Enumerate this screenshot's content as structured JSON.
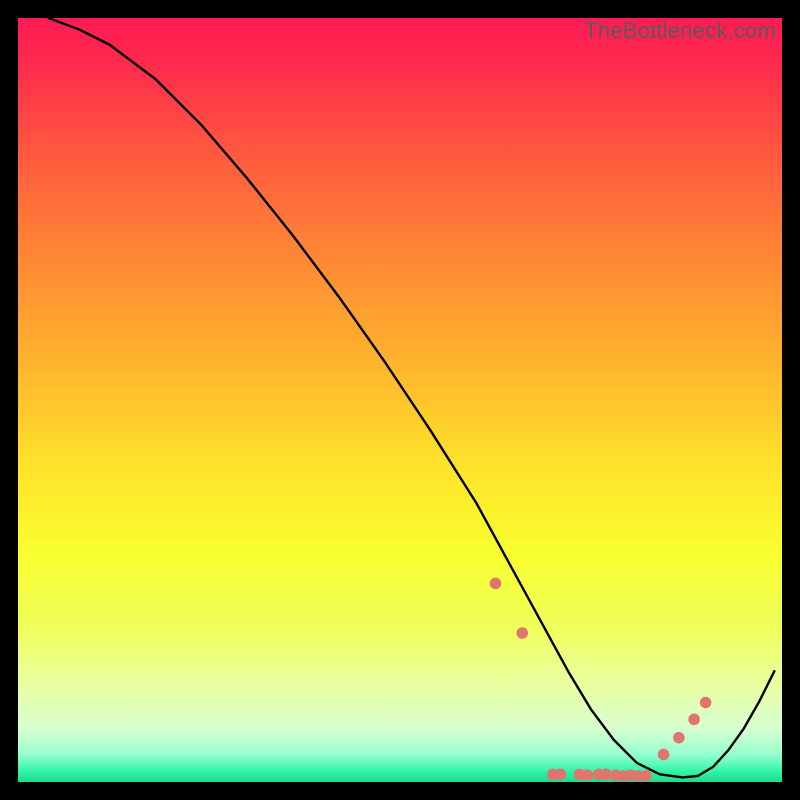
{
  "watermark": "TheBottleneck.com",
  "chart_data": {
    "type": "line",
    "title": "",
    "xlabel": "",
    "ylabel": "",
    "xlim": [
      0,
      100
    ],
    "ylim": [
      0,
      100
    ],
    "grid": false,
    "legend": false,
    "gradient_stops": [
      {
        "offset": 0.0,
        "color": "#ff1b53"
      },
      {
        "offset": 0.06,
        "color": "#ff2a4d"
      },
      {
        "offset": 0.18,
        "color": "#ff5a3e"
      },
      {
        "offset": 0.32,
        "color": "#ff8a34"
      },
      {
        "offset": 0.46,
        "color": "#ffb72d"
      },
      {
        "offset": 0.58,
        "color": "#ffe12a"
      },
      {
        "offset": 0.7,
        "color": "#f8ff2e"
      },
      {
        "offset": 0.8,
        "color": "#efff5c"
      },
      {
        "offset": 0.88,
        "color": "#e8ffa8"
      },
      {
        "offset": 0.93,
        "color": "#d8ffd0"
      },
      {
        "offset": 0.965,
        "color": "#93ffce"
      },
      {
        "offset": 0.985,
        "color": "#34f7a8"
      },
      {
        "offset": 1.0,
        "color": "#20d88e"
      }
    ],
    "series": [
      {
        "name": "bottleneck-curve",
        "color": "#000000",
        "x": [
          4,
          8,
          12,
          18,
          24,
          30,
          36,
          42,
          48,
          54,
          60,
          63,
          66,
          69,
          72,
          75,
          78,
          81,
          84,
          87,
          89,
          91,
          93,
          95,
          97,
          99
        ],
        "y": [
          100,
          98.5,
          96.5,
          92,
          86,
          79,
          71.5,
          63.5,
          55,
          46,
          36.5,
          31,
          25.5,
          20,
          14.5,
          9.5,
          5.5,
          2.5,
          1.0,
          0.6,
          0.8,
          2.0,
          4.2,
          7.0,
          10.5,
          14.5
        ]
      }
    ],
    "markers": {
      "name": "salmon-dots",
      "color": "#e0756f",
      "radius": 5.8,
      "points": [
        {
          "x": 62.5,
          "y": 26.0
        },
        {
          "x": 66.0,
          "y": 19.5
        },
        {
          "x": 70.0,
          "y": 1.0
        },
        {
          "x": 71.0,
          "y": 1.0
        },
        {
          "x": 73.5,
          "y": 1.0
        },
        {
          "x": 74.5,
          "y": 0.9
        },
        {
          "x": 76.0,
          "y": 1.0
        },
        {
          "x": 77.0,
          "y": 1.0
        },
        {
          "x": 78.2,
          "y": 0.9
        },
        {
          "x": 79.2,
          "y": 0.8
        },
        {
          "x": 80.2,
          "y": 0.9
        },
        {
          "x": 81.2,
          "y": 0.8
        },
        {
          "x": 82.2,
          "y": 0.8
        },
        {
          "x": 84.5,
          "y": 3.6
        },
        {
          "x": 86.5,
          "y": 5.8
        },
        {
          "x": 88.5,
          "y": 8.2
        },
        {
          "x": 90.0,
          "y": 10.4
        }
      ]
    }
  }
}
